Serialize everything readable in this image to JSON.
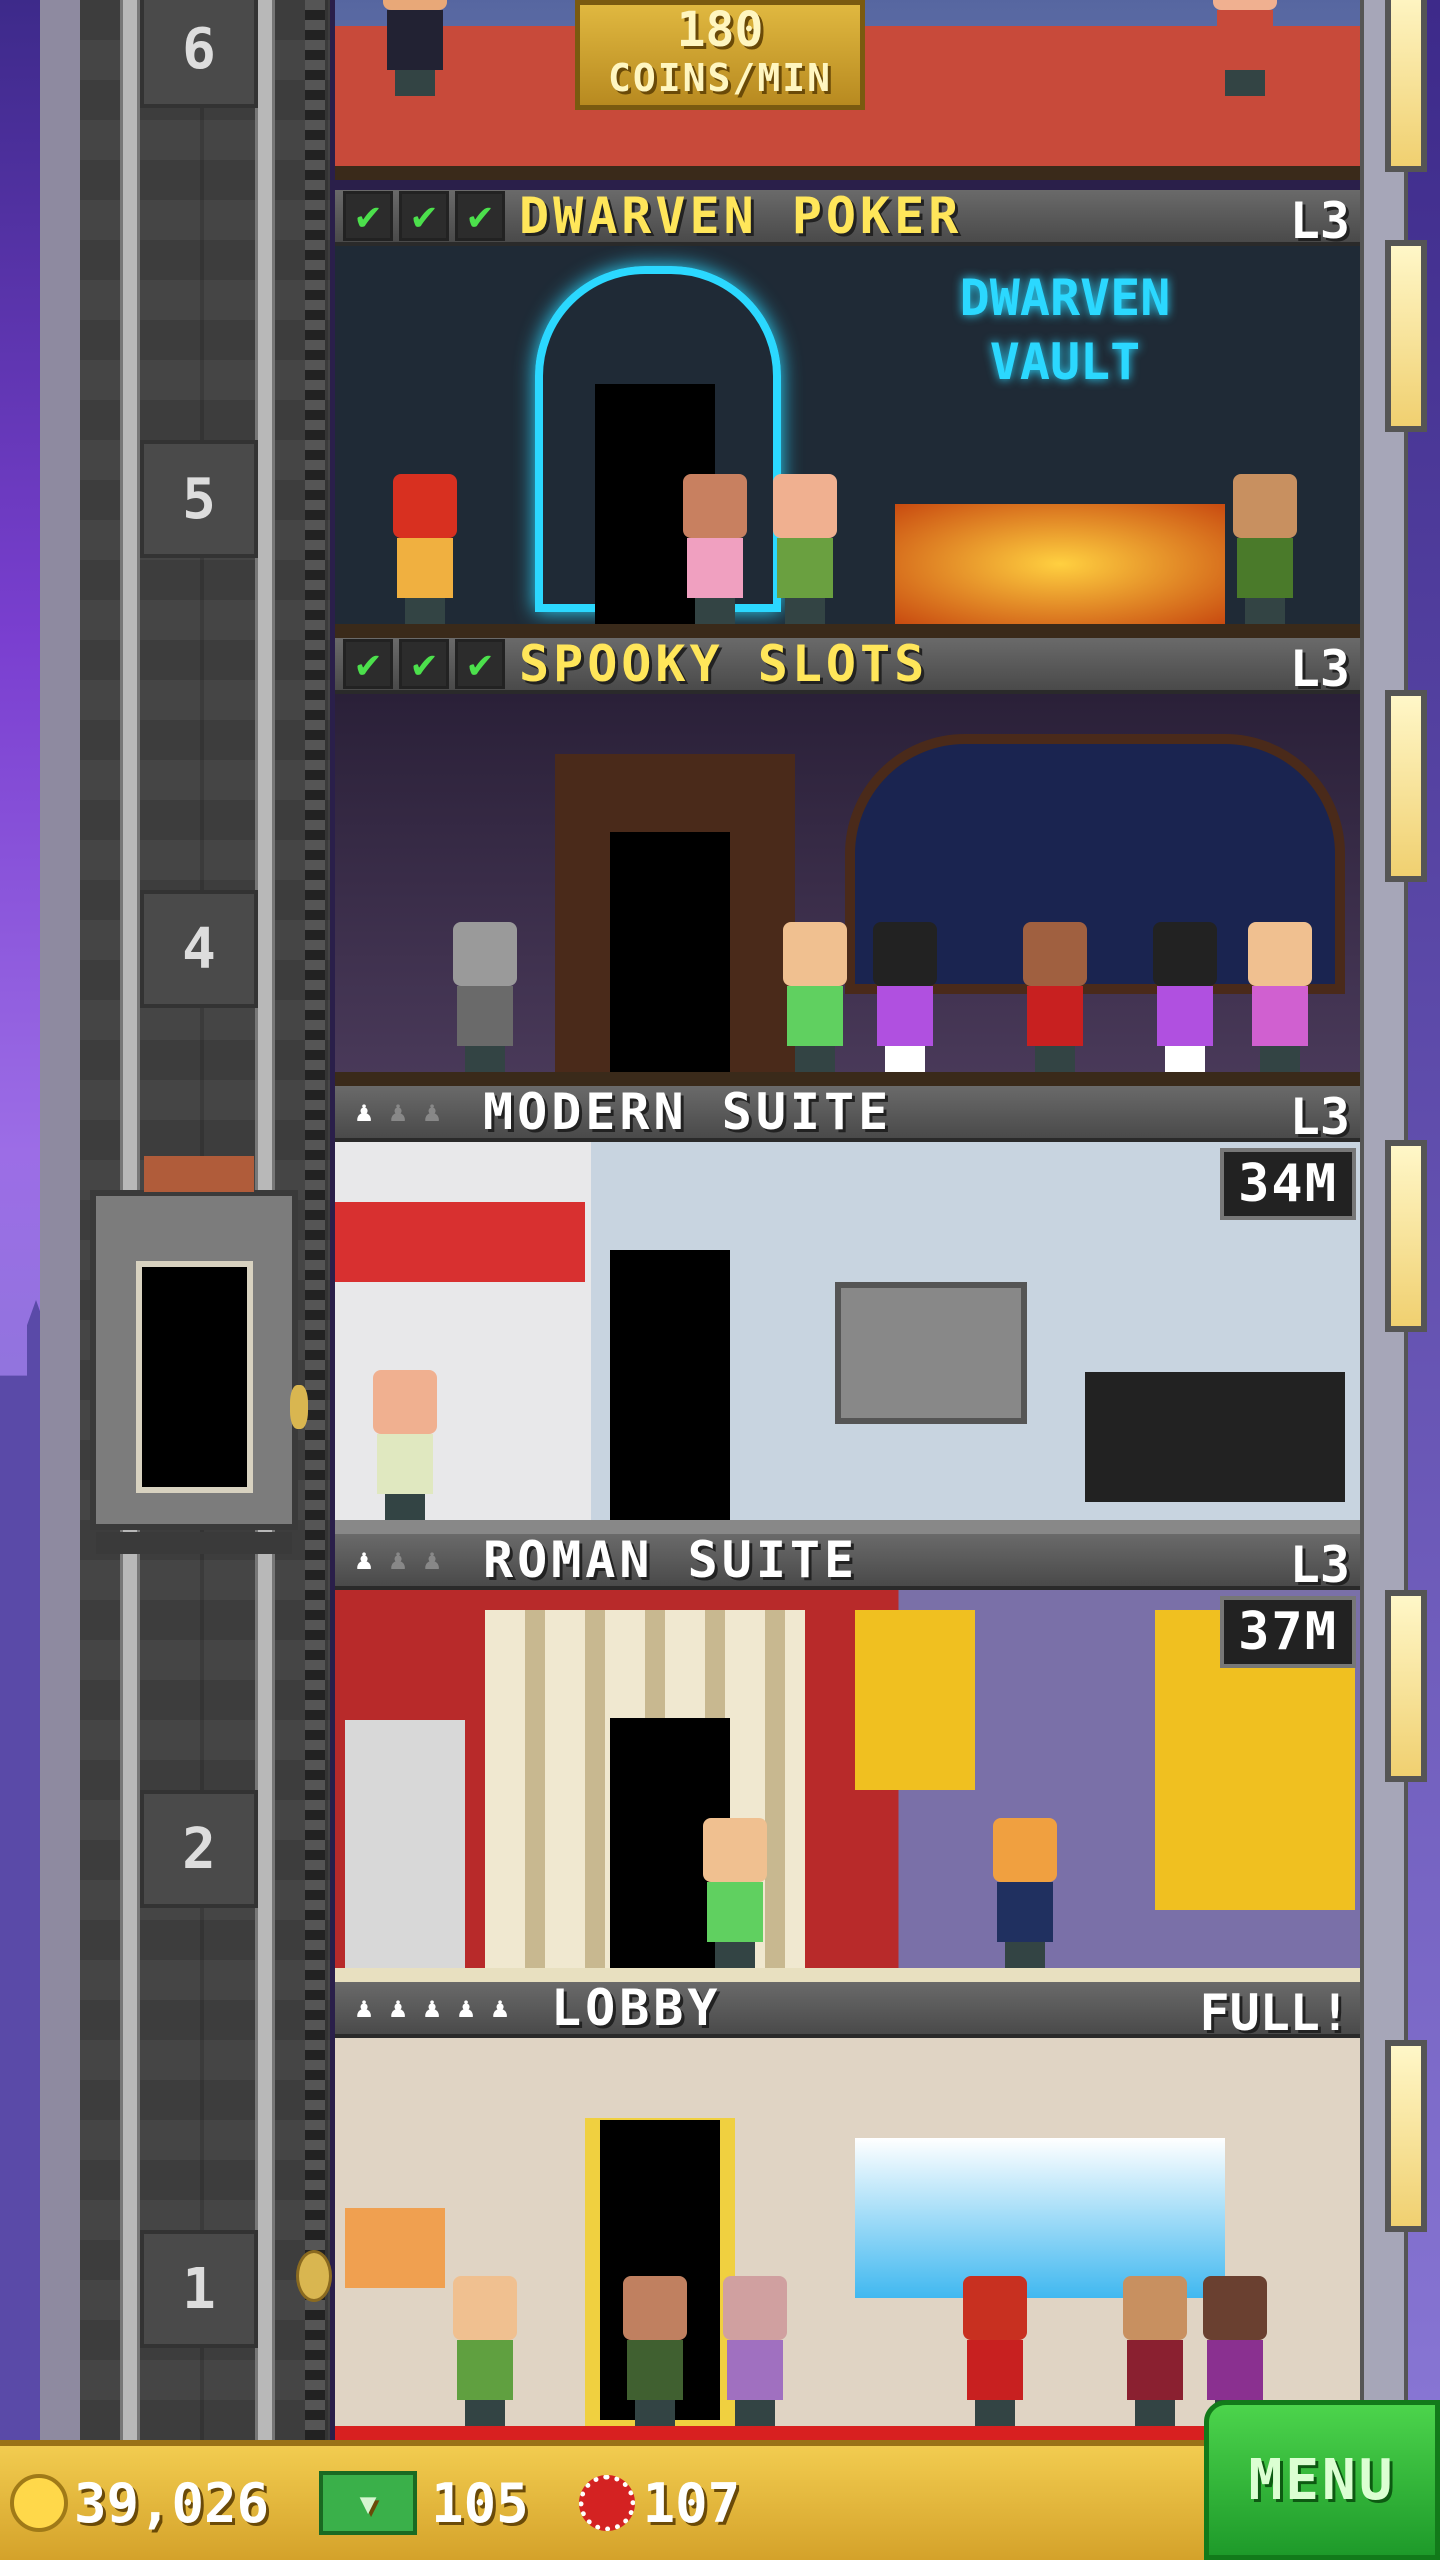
{
  "top_banner": {
    "amount": "180",
    "unit": "COINS/MIN"
  },
  "shaft_floor_numbers": [
    "6",
    "5",
    "4",
    "2",
    "1"
  ],
  "floors": [
    {
      "name": "DWARVEN POKER",
      "level": "L3",
      "checks": [
        "✔",
        "✔",
        "✔"
      ],
      "sign_text": "DWARVEN VAULT"
    },
    {
      "name": "SPOOKY SLOTS",
      "level": "L3",
      "checks": [
        "✔",
        "✔",
        "✔"
      ]
    },
    {
      "name": "MODERN SUITE",
      "level": "L3",
      "timer": "34M",
      "slots": 3,
      "filled": 1
    },
    {
      "name": "ROMAN SUITE",
      "level": "L3",
      "timer": "37M",
      "slots": 3,
      "filled": 1
    },
    {
      "name": "LOBBY",
      "level": "FULL!",
      "slots": 5,
      "filled": 5
    }
  ],
  "bottom_bar": {
    "coins": "39,026",
    "bux": "105",
    "chips": "107",
    "menu_label": "MENU"
  },
  "colors": {
    "gold_text": "#ffe65a",
    "check_green": "#4ce04c",
    "menu_green": "#2db83a",
    "bar_gold": "#e6b83c"
  }
}
